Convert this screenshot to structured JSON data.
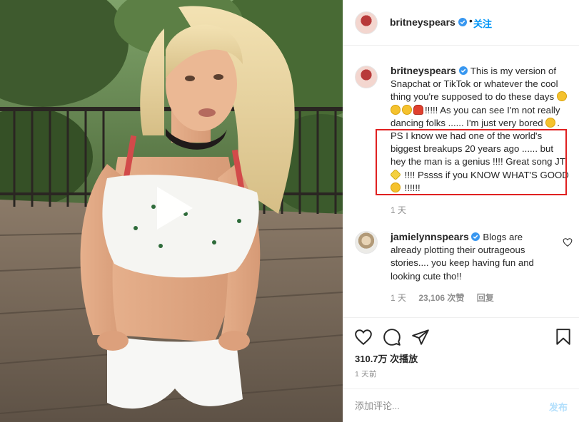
{
  "post": {
    "username": "britneyspears",
    "follow_label": "关注",
    "dot": "•"
  },
  "media": {
    "type": "video",
    "play_icon": "play-icon"
  },
  "caption": {
    "username": "britneyspears",
    "text_1": "This is my version of Snapchat or TikTok or whatever the cool thing you're supposed to do these days ",
    "text_2": "!!!!! As you can see I'm not really dancing folks ...... I'm just very bored ",
    "text_3": ". PS I know we had one of the world's biggest breakups 20 years ago ...... but hey the man is a genius !!!! Great song JT ",
    "text_4": " !!!! Pssss if you KNOW WHAT'S GOOD ",
    "text_5": " !!!!!!",
    "time": "1 天",
    "highlight_color": "#e02020"
  },
  "comment": {
    "username": "jamielynnspears",
    "text": "Blogs are already plotting their outrageous stories.... you keep having fun and looking cute tho!!",
    "time": "1 天",
    "likes": "23,106 次赞",
    "reply_label": "回复"
  },
  "actions": {
    "views": "310.7万 次播放",
    "posted_ago": "1 天前",
    "icons": [
      "heart-icon",
      "comment-icon",
      "share-icon",
      "bookmark-icon"
    ]
  },
  "add_comment": {
    "placeholder": "添加评论...",
    "post_label": "发布"
  },
  "colors": {
    "accent": "#0095f6",
    "verified": "#3897f0",
    "post_disabled": "#b2dffc",
    "text_primary": "#262626",
    "text_secondary": "#8e8e8e"
  }
}
